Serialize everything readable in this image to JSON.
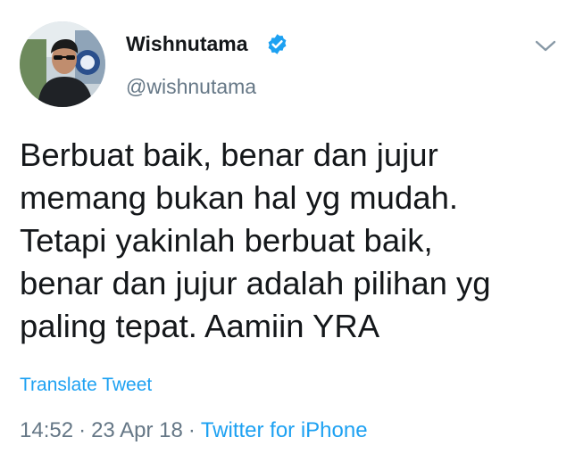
{
  "tweet": {
    "author": {
      "display_name": "Wishnutama",
      "handle": "@wishnutama",
      "verified_icon": "verified-badge-icon"
    },
    "menu_icon": "chevron-down-icon",
    "text_lines": [
      "Berbuat baik, benar dan jujur",
      "memang bukan hal yg mudah.",
      "Tetapi yakinlah berbuat baik,",
      "benar dan jujur adalah pilihan yg",
      "paling tepat. Aamiin YRA"
    ],
    "translate_label": "Translate Tweet",
    "time": "14:52",
    "separator": "·",
    "date": "23 Apr 18",
    "source": "Twitter for iPhone"
  },
  "colors": {
    "link": "#1da1f2",
    "secondary_text": "#657786",
    "primary_text": "#14171a",
    "verified": "#1da1f2"
  }
}
